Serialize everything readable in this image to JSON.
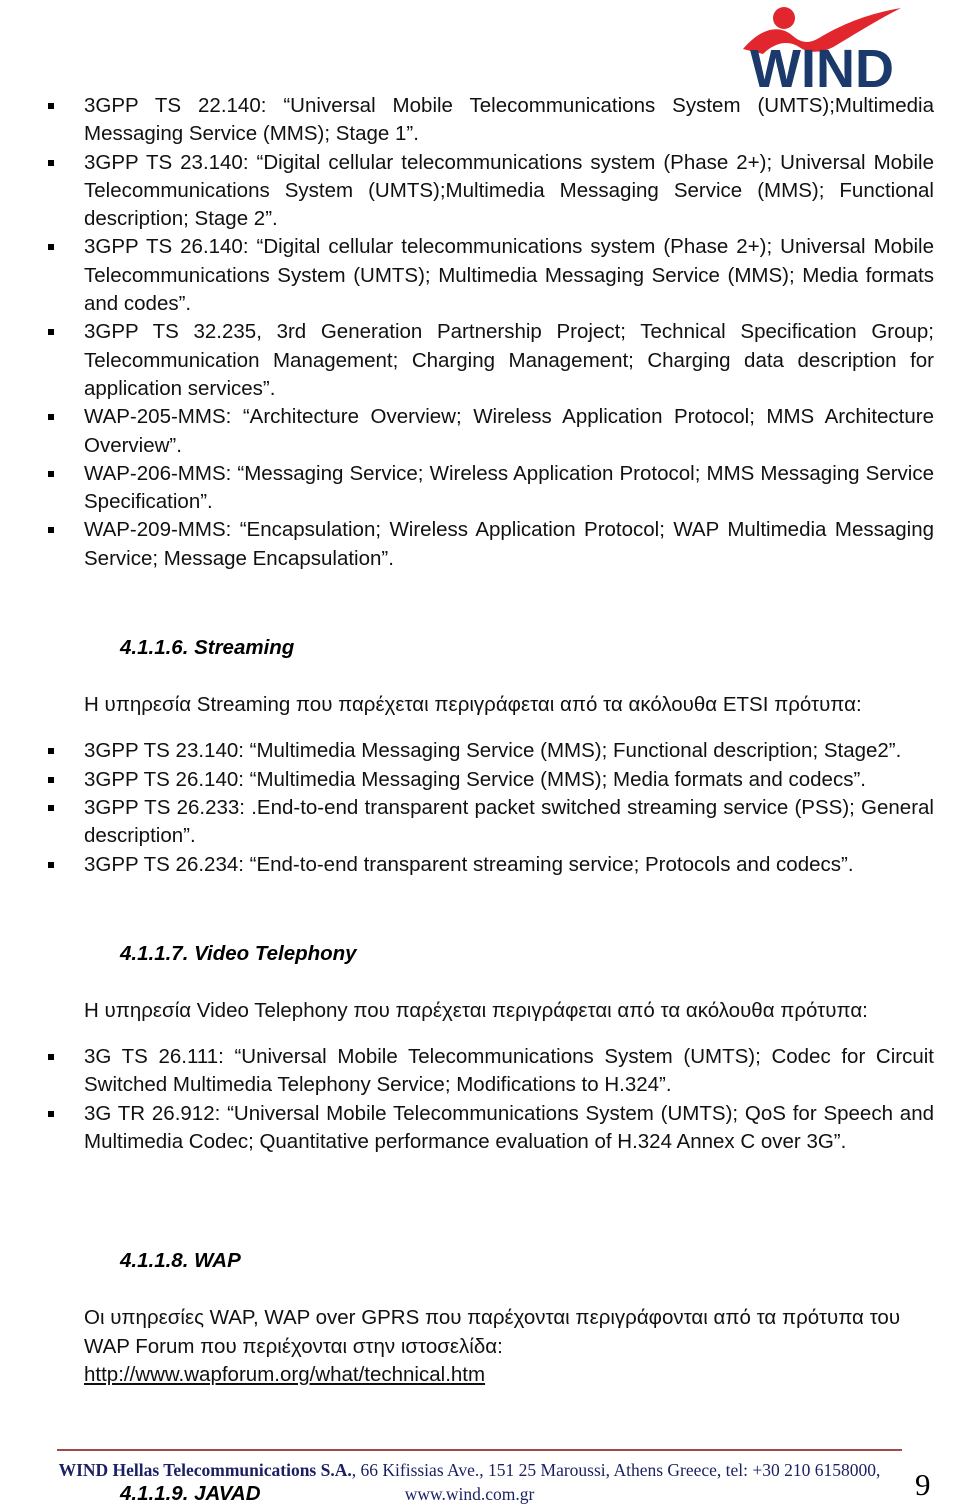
{
  "logo": {
    "wordmark": "WIND",
    "wordmark_color": "#1b3a6b",
    "swoosh_color": "#e1262d"
  },
  "mms_standards": {
    "items": [
      "3GPP TS 22.140: “Universal Mobile Telecommunications System (UMTS);Multimedia Messaging Service (MMS); Stage 1”.",
      "3GPP TS 23.140: “Digital cellular telecommunications system (Phase 2+); Universal Mobile Telecommunications System (UMTS);Multimedia Messaging Service (MMS); Functional description; Stage 2”.",
      "3GPP TS 26.140: “Digital cellular telecommunications system (Phase 2+); Universal Mobile Telecommunications System (UMTS); Multimedia Messaging Service (MMS); Media formats and codes”.",
      "3GPP TS 32.235, 3rd Generation Partnership Project; Technical Specification Group; Telecommunication Management; Charging Management; Charging data description for application services”.",
      "WAP-205-MMS: “Architecture Overview; Wireless Application Protocol; MMS Architecture Overview”.",
      "WAP-206-MMS: “Messaging Service; Wireless Application Protocol; MMS Messaging Service Specification”.",
      "WAP-209-MMS: “Encapsulation; Wireless Application Protocol; WAP Multimedia Messaging Service; Message Encapsulation”."
    ]
  },
  "sections": [
    {
      "heading": "4.1.1.6. Streaming",
      "intro": "Η υπηρεσία Streaming που παρέχεται περιγράφεται από τα ακόλουθα ETSI πρότυπα:",
      "items": [
        "3GPP TS 23.140: “Multimedia Messaging Service (MMS); Functional description; Stage2”.",
        "3GPP TS 26.140: “Multimedia Messaging Service (MMS); Media formats and codecs”.",
        "3GPP TS 26.233: .End-to-end transparent packet switched streaming service (PSS); General description”.",
        "3GPP TS 26.234: “End-to-end transparent streaming service; Protocols and codecs”."
      ]
    },
    {
      "heading": "4.1.1.7. Video Telephony",
      "intro": "Η υπηρεσία Video Telephony που παρέχεται περιγράφεται από τα ακόλουθα πρότυπα:",
      "items": [
        "3G TS 26.111: “Universal Mobile Telecommunications System (UMTS); Codec for Circuit Switched Multimedia Telephony Service; Modifications to H.324”.",
        "3G TR 26.912: “Universal Mobile Telecommunications System (UMTS); QoS for Speech and Multimedia Codec; Quantitative performance evaluation of H.324 Annex C over 3G”."
      ]
    }
  ],
  "wap_section": {
    "heading": "4.1.1.8. WAP",
    "paragraph_line1": "Οι υπηρεσίες WAP, WAP over GPRS που παρέχονται περιγράφονται από τα πρότυπα",
    "paragraph_line2": "του WAP Forum που περιέχονται στην ιστοσελίδα:",
    "link": "http://www.wapforum.org/what/technical.htm"
  },
  "javad_section": {
    "heading": "4.1.1.9. JAVAD"
  },
  "footer": {
    "company": "WIND Hellas Telecommunications S.A.",
    "address": ", 66 Kifissias Ave., 151 25 Maroussi, Athens Greece, tel: +30 210 6158000,",
    "website": "www.wind.com.gr",
    "page_number": "9",
    "rule_color": "#9e4a4a",
    "text_color": "#1b1f63"
  }
}
